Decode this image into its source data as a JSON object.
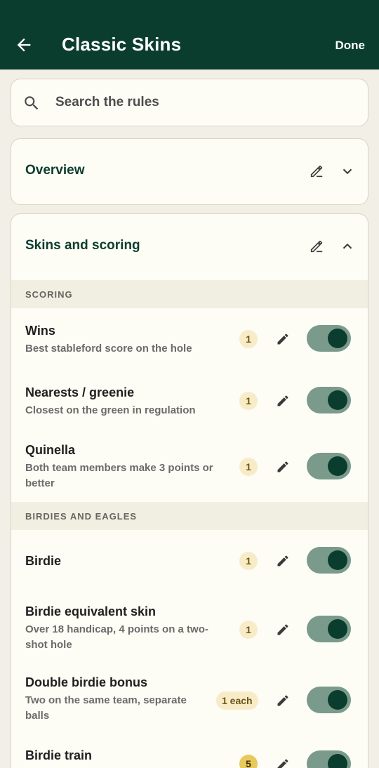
{
  "appbar": {
    "title": "Classic Skins",
    "done_label": "Done",
    "back_icon": "arrow-left-icon"
  },
  "search": {
    "placeholder": "Search the rules",
    "icon": "search-icon"
  },
  "cards": {
    "overview": {
      "title": "Overview",
      "expanded": false
    },
    "skins": {
      "title": "Skins and scoring",
      "expanded": true
    }
  },
  "sections": {
    "scoring": "SCORING",
    "birdies": "BIRDIES AND EAGLES"
  },
  "rules": {
    "wins": {
      "name": "Wins",
      "desc": "Best stableford score on the hole",
      "badge": "1",
      "enabled": true
    },
    "nearests": {
      "name": "Nearests / greenie",
      "desc": "Closest on the green in regulation",
      "badge": "1",
      "enabled": true
    },
    "quinella": {
      "name": "Quinella",
      "desc": "Both team members make 3 points or better",
      "badge": "1",
      "enabled": true
    },
    "birdie": {
      "name": "Birdie",
      "badge": "1",
      "enabled": true
    },
    "birdie_equiv": {
      "name": "Birdie equivalent skin",
      "desc": "Over 18 handicap, 4 points on a two-shot hole",
      "badge": "1",
      "enabled": true
    },
    "double_birdie": {
      "name": "Double birdie bonus",
      "desc": "Two on the same team, separate balls",
      "badge": "1 each",
      "enabled": true
    },
    "birdie_train": {
      "name": "Birdie train",
      "badge": "5",
      "enabled": true
    }
  },
  "colors": {
    "primary": "#0b3d2e",
    "background": "#f1efe6",
    "card": "#fdfcf5",
    "badge": "#f8ecc8",
    "toggle_track": "#7a9a8c"
  }
}
